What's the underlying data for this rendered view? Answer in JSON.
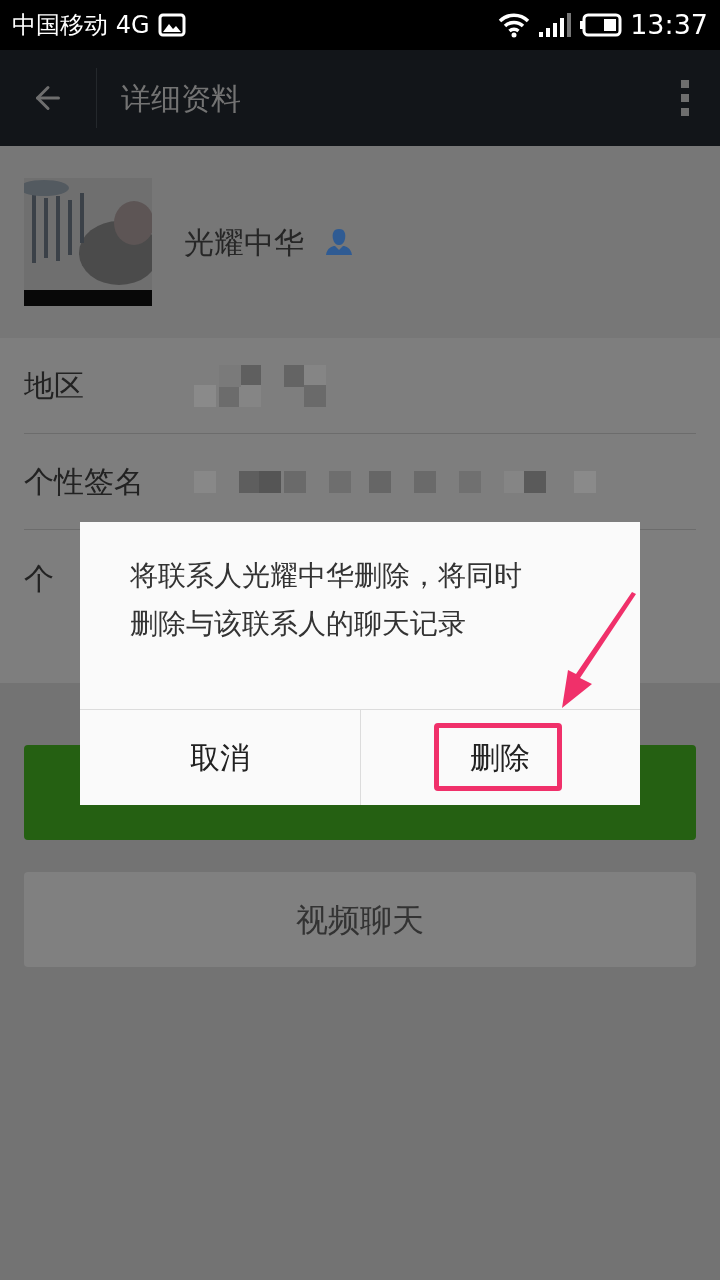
{
  "status_bar": {
    "carrier": "中国移动 4G",
    "time": "13:37"
  },
  "header": {
    "title": "详细资料"
  },
  "profile": {
    "name": "光耀中华"
  },
  "fields": [
    {
      "label": "地区",
      "blurred": true
    },
    {
      "label": "个性签名",
      "blurred": true
    },
    {
      "label": "个",
      "blurred": false
    }
  ],
  "video_button": {
    "label": "视频聊天"
  },
  "dialog": {
    "message": "将联系人光耀中华删除，将同时删除与该联系人的聊天记录",
    "buttons": [
      {
        "label": "取消",
        "highlighted": false
      },
      {
        "label": "删除",
        "highlighted": true
      }
    ]
  }
}
